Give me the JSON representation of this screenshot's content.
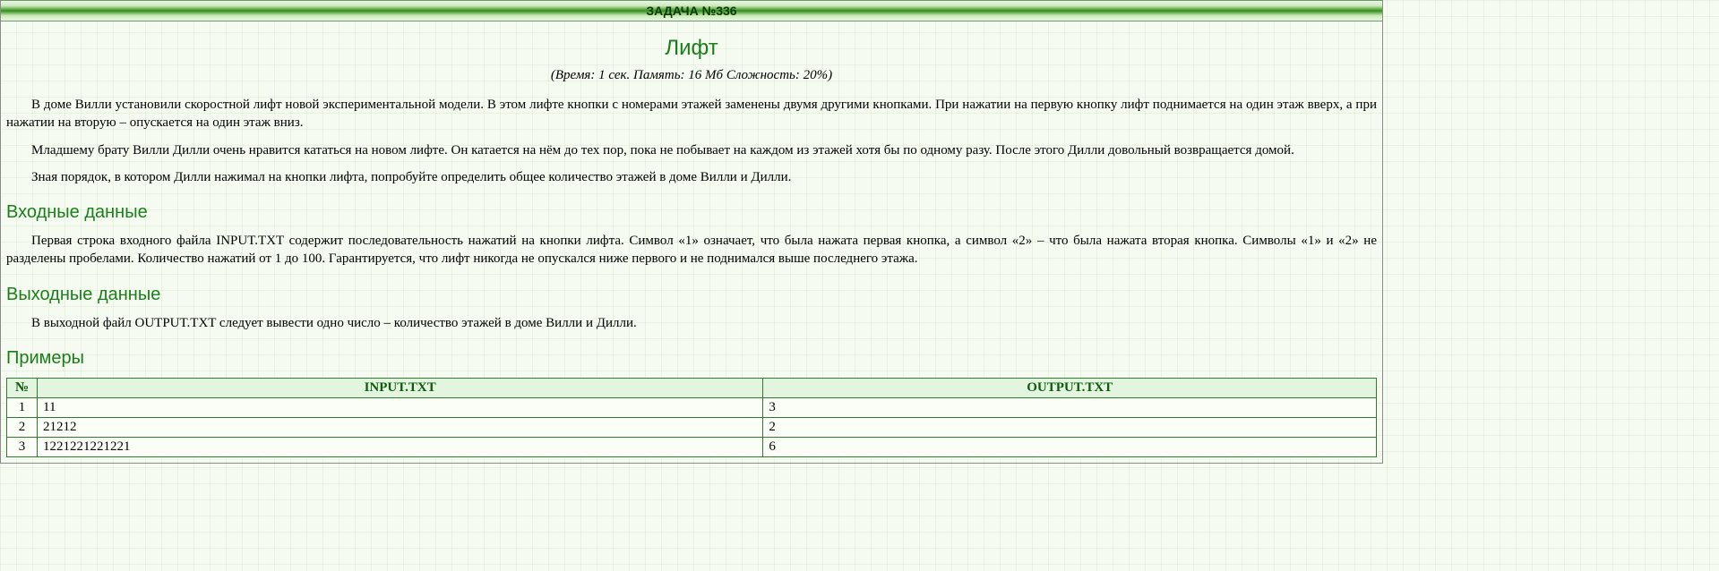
{
  "header": "ЗАДАЧА №336",
  "title": "Лифт",
  "meta": "(Время: 1 сек. Память: 16 Мб Сложность: 20%)",
  "paragraphs": {
    "p1": "В доме Вилли установили скоростной лифт новой экспериментальной модели. В этом лифте кнопки с номерами этажей заменены двумя другими кнопками. При нажатии на первую кнопку лифт поднимается на один этаж вверх, а при нажатии на вторую – опускается на один этаж вниз.",
    "p2": "Младшему брату Вилли Дилли очень нравится кататься на новом лифте. Он катается на нём до тех пор, пока не побывает на каждом из этажей хотя бы по одному разу. После этого Дилли довольный возвращается домой.",
    "p3": "Зная порядок, в котором Дилли нажимал на кнопки лифта, попробуйте определить общее количество этажей в доме Вилли и Дилли.",
    "input": "Первая строка входного файла INPUT.TXT содержит последовательность нажатий на кнопки лифта. Символ «1» означает, что была нажата первая кнопка, а символ «2» – что была нажата вторая кнопка. Символы «1» и «2» не разделены пробелами. Количество нажатий от 1 до 100. Гарантируется, что лифт никогда не опускался ниже первого и не поднимался выше последнего этажа.",
    "output": "В выходной файл OUTPUT.TXT следует вывести одно число – количество этажей в доме Вилли и Дилли."
  },
  "sections": {
    "input_heading": "Входные данные",
    "output_heading": "Выходные данные",
    "examples_heading": "Примеры"
  },
  "table": {
    "headers": {
      "num": "№",
      "input": "INPUT.TXT",
      "output": "OUTPUT.TXT"
    },
    "rows": [
      {
        "n": "1",
        "in": "11",
        "out": "3"
      },
      {
        "n": "2",
        "in": "21212",
        "out": "2"
      },
      {
        "n": "3",
        "in": "1221221221221",
        "out": "6"
      }
    ]
  }
}
